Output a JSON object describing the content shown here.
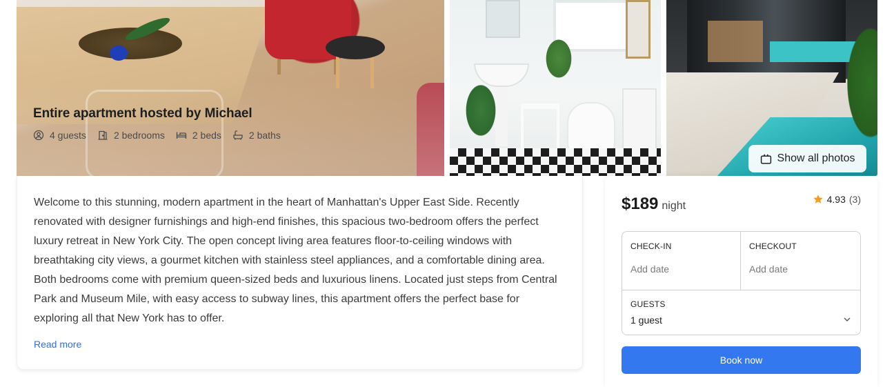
{
  "listing": {
    "title": "Entire apartment hosted by Michael",
    "facts": {
      "guests": "4 guests",
      "bedrooms": "2 bedrooms",
      "beds": "2 beds",
      "baths": "2 baths"
    }
  },
  "gallery": {
    "show_all_label": "Show all photos",
    "icons": [
      "user-icon",
      "door-icon",
      "bed-icon",
      "bath-icon",
      "photos-icon"
    ]
  },
  "description": {
    "text": "Welcome to this stunning, modern apartment in the heart of Manhattan's Upper East Side. Recently renovated with designer furnishings and high-end finishes, this spacious two-bedroom offers the perfect luxury retreat in New York City. The open concept living area features floor-to-ceiling windows with breathtaking city views, a gourmet kitchen with stainless steel appliances, and a comfortable dining area. Both bedrooms come with premium queen-sized beds and luxurious linens. Located just steps from Central Park and Museum Mile, with easy access to subway lines, this apartment offers the perfect base for exploring all that New York has to offer.",
    "read_more": "Read more"
  },
  "booking": {
    "price": "$189",
    "price_unit": "night",
    "rating": "4.93",
    "review_count": "(3)",
    "checkin_label": "CHECK-IN",
    "checkin_value": "Add date",
    "checkout_label": "CHECKOUT",
    "checkout_value": "Add date",
    "guests_label": "GUESTS",
    "guests_value": "1 guest",
    "book_label": "Book now"
  },
  "colors": {
    "accent": "#3478f0",
    "link": "#2f6fe0",
    "star": "#f59e1b"
  }
}
